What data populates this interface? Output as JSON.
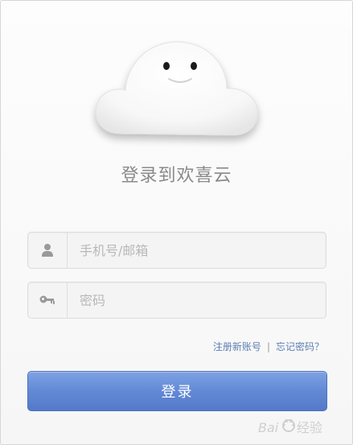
{
  "title": "登录到欢喜云",
  "fields": {
    "account": {
      "placeholder": "手机号/邮箱",
      "value": "",
      "icon": "user-icon"
    },
    "password": {
      "placeholder": "密码",
      "value": "",
      "icon": "key-icon"
    }
  },
  "links": {
    "register": "注册新账号",
    "separator": "|",
    "forgot": "忘记密码？"
  },
  "login_button": "登录",
  "watermark": "Baidu经验",
  "colors": {
    "accent": "#5e7fb4",
    "button": "#6289d6",
    "title": "#8a8a8a"
  }
}
